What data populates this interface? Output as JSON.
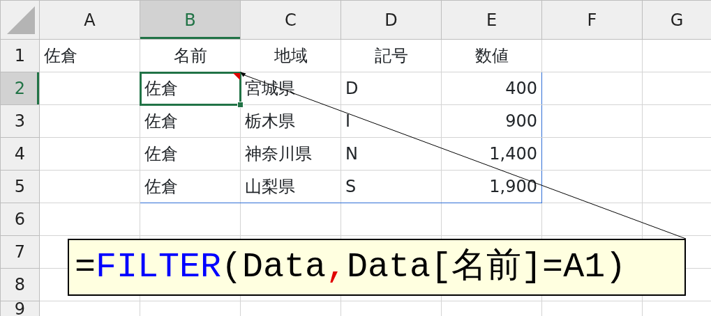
{
  "columns": [
    {
      "label": "A",
      "selected": false
    },
    {
      "label": "B",
      "selected": true
    },
    {
      "label": "C",
      "selected": false
    },
    {
      "label": "D",
      "selected": false
    },
    {
      "label": "E",
      "selected": false
    },
    {
      "label": "F",
      "selected": false
    },
    {
      "label": "G",
      "selected": false
    }
  ],
  "rows": [
    {
      "label": "1",
      "selected": false,
      "cells": [
        {
          "text": "佐倉",
          "kind": "text"
        },
        {
          "text": "名前",
          "kind": "header"
        },
        {
          "text": "地域",
          "kind": "header"
        },
        {
          "text": "記号",
          "kind": "header"
        },
        {
          "text": "数値",
          "kind": "header"
        },
        null,
        null
      ]
    },
    {
      "label": "2",
      "selected": true,
      "cells": [
        null,
        {
          "text": "佐倉",
          "kind": "text",
          "selected": true,
          "comment": true,
          "spill": true
        },
        {
          "text": "宮城県",
          "kind": "text",
          "spill": true
        },
        {
          "text": "D",
          "kind": "text",
          "spill": true
        },
        {
          "text": "400",
          "kind": "number",
          "spill": true
        },
        null,
        null
      ]
    },
    {
      "label": "3",
      "selected": false,
      "cells": [
        null,
        {
          "text": "佐倉",
          "kind": "text",
          "spill": true
        },
        {
          "text": "栃木県",
          "kind": "text",
          "spill": true
        },
        {
          "text": "I",
          "kind": "text",
          "spill": true
        },
        {
          "text": "900",
          "kind": "number",
          "spill": true
        },
        null,
        null
      ]
    },
    {
      "label": "4",
      "selected": false,
      "cells": [
        null,
        {
          "text": "佐倉",
          "kind": "text",
          "spill": true
        },
        {
          "text": "神奈川県",
          "kind": "text",
          "spill": true
        },
        {
          "text": "N",
          "kind": "text",
          "spill": true
        },
        {
          "text": "1,400",
          "kind": "number",
          "spill": true
        },
        null,
        null
      ]
    },
    {
      "label": "5",
      "selected": false,
      "cells": [
        null,
        {
          "text": "佐倉",
          "kind": "text",
          "spill": true
        },
        {
          "text": "山梨県",
          "kind": "text",
          "spill": true
        },
        {
          "text": "S",
          "kind": "text",
          "spill": true
        },
        {
          "text": "1,900",
          "kind": "number",
          "spill": true
        },
        null,
        null
      ]
    },
    {
      "label": "6",
      "selected": false,
      "cells": [
        null,
        null,
        null,
        null,
        null,
        null,
        null
      ]
    },
    {
      "label": "7",
      "selected": false,
      "cells": [
        null,
        null,
        null,
        null,
        null,
        null,
        null
      ]
    },
    {
      "label": "8",
      "selected": false,
      "cells": [
        null,
        null,
        null,
        null,
        null,
        null,
        null
      ]
    },
    {
      "label": "9",
      "selected": false,
      "cells": [
        null,
        null,
        null,
        null,
        null,
        null,
        null
      ]
    }
  ],
  "callout": {
    "formula": [
      {
        "kind": "plain",
        "text": "="
      },
      {
        "kind": "function",
        "text": "FILTER"
      },
      {
        "kind": "plain",
        "text": "(Data"
      },
      {
        "kind": "separator",
        "text": ","
      },
      {
        "kind": "plain",
        "text": "Data[名前]=A1)"
      }
    ]
  }
}
